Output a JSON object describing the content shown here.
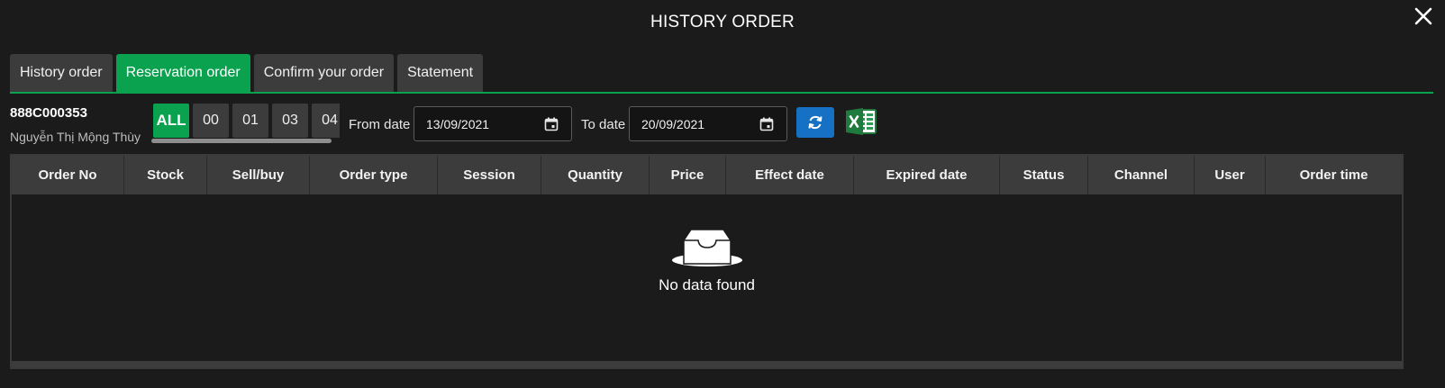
{
  "modal": {
    "title": "HISTORY ORDER"
  },
  "tabs": [
    {
      "label": "History order",
      "active": false
    },
    {
      "label": "Reservation order",
      "active": true
    },
    {
      "label": "Confirm your order",
      "active": false
    },
    {
      "label": "Statement",
      "active": false
    }
  ],
  "account": {
    "id": "888C000353",
    "name": "Nguyễn Thị Mộng Thùy"
  },
  "sub_accounts": [
    "ALL",
    "00",
    "01",
    "03",
    "04"
  ],
  "filters": {
    "from_label": "From date",
    "from_value": "13/09/2021",
    "to_label": "To date",
    "to_value": "20/09/2021"
  },
  "table": {
    "columns": [
      "Order No",
      "Stock",
      "Sell/buy",
      "Order type",
      "Session",
      "Quantity",
      "Price",
      "Effect date",
      "Expired date",
      "Status",
      "Channel",
      "User",
      "Order time"
    ],
    "empty_text": "No data found"
  },
  "icons": {
    "close": "close-icon",
    "calendar": "calendar-icon",
    "refresh": "refresh-icon",
    "excel": "excel-icon",
    "empty": "empty-inbox-icon"
  },
  "colors": {
    "accent": "#0aa24f",
    "refresh": "#1670c4",
    "excel": "#1f7a3d",
    "background": "#1b1b1b",
    "tab": "#3c3c3c"
  }
}
